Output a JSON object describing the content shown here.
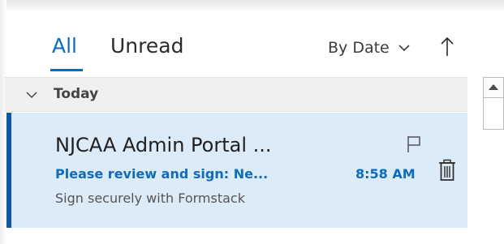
{
  "filter_bar": {
    "tabs": [
      {
        "label": "All",
        "active": true
      },
      {
        "label": "Unread",
        "active": false
      }
    ],
    "sort_label": "By Date",
    "sort_direction_icon": "arrow-up-icon",
    "accent_color": "#0f6cbd"
  },
  "group": {
    "label": "Today",
    "expanded": true
  },
  "message": {
    "sender": "NJCAA Admin Portal ...",
    "subject": "Please review and sign: Ne...",
    "preview": "Sign securely with Formstack",
    "time": "8:58 AM",
    "selected": true,
    "selected_background": "#dcebf8"
  }
}
